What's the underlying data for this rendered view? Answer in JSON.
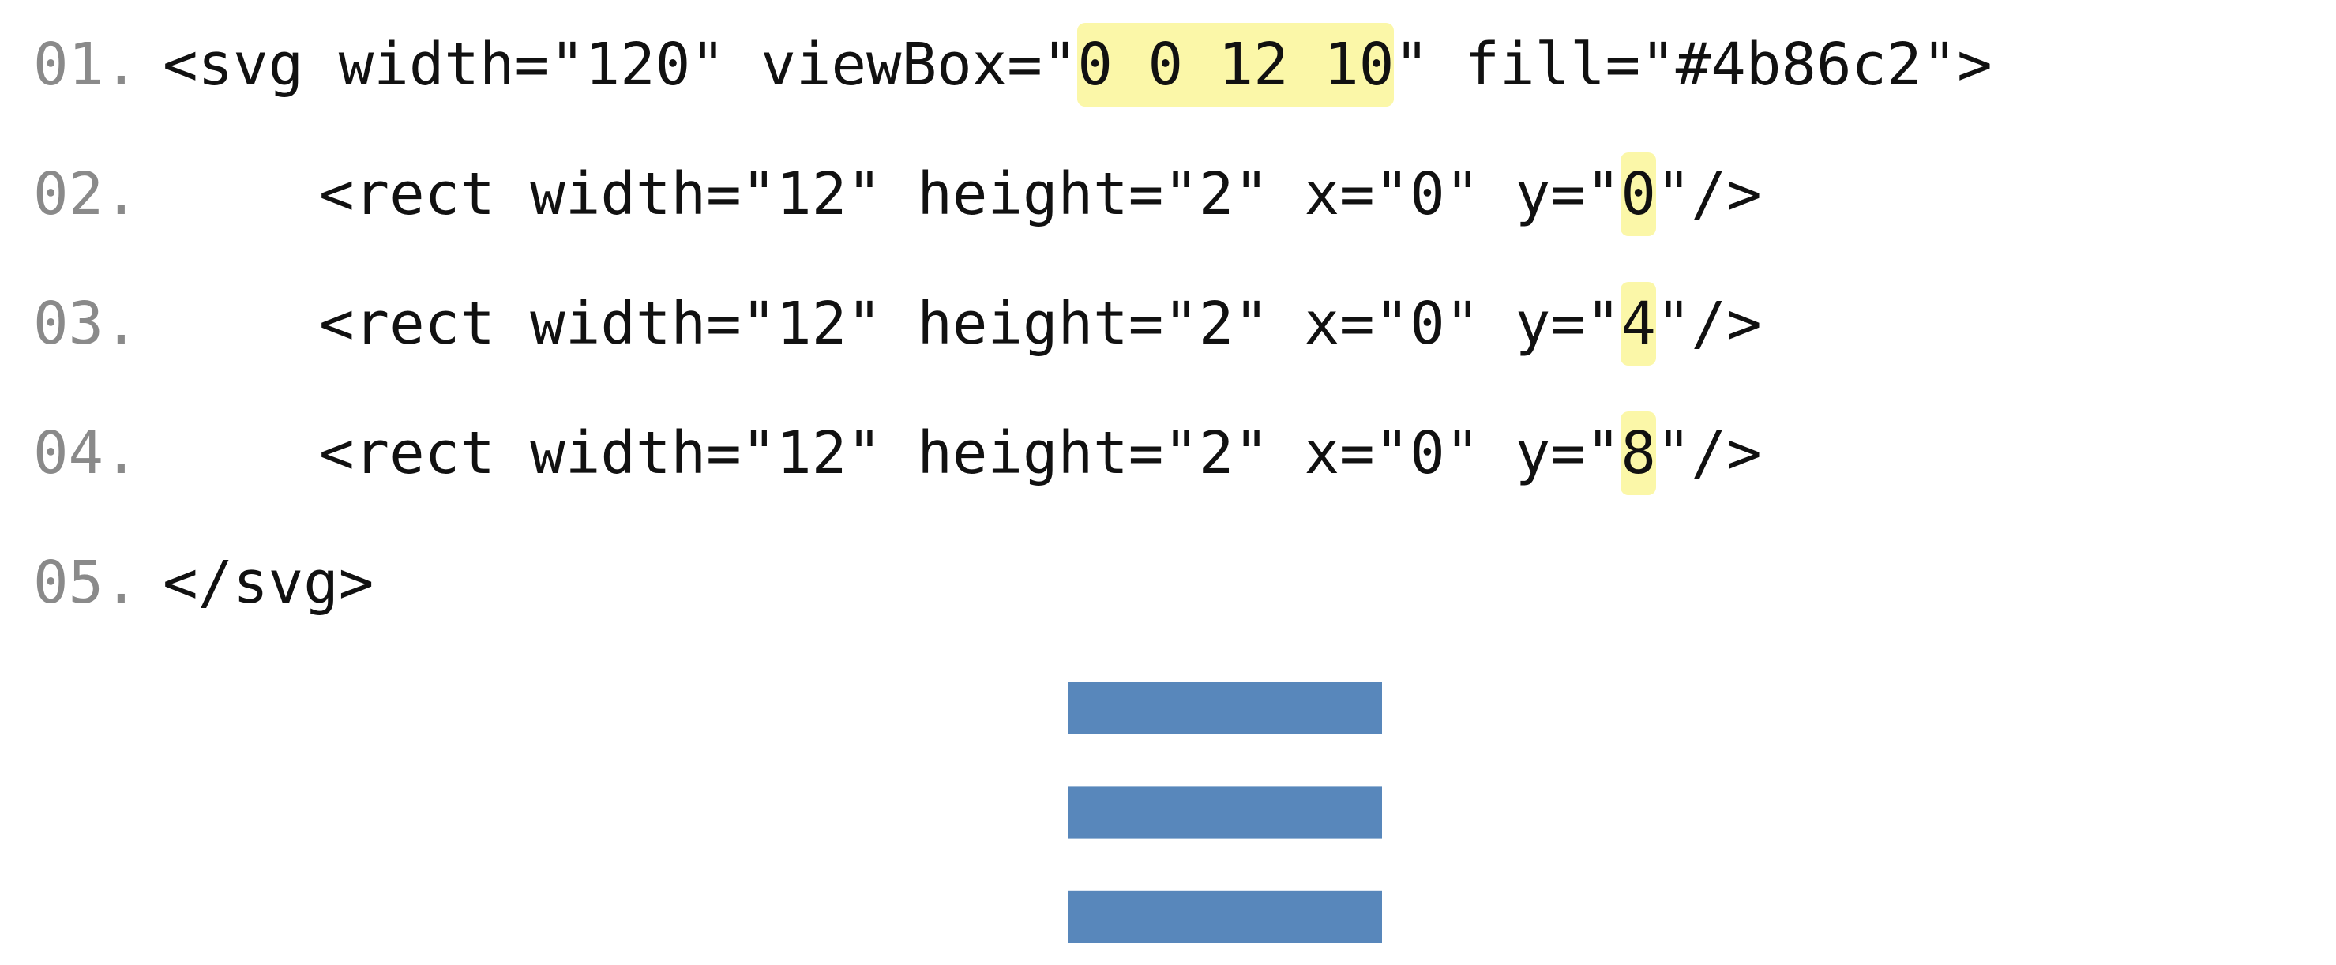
{
  "code": {
    "lines": [
      {
        "number": "01.",
        "pre": "<svg width=\"120\" viewBox=\"",
        "highlight": "0 0 12 10",
        "post": "\" fill=\"#4b86c2\">"
      },
      {
        "number": "02.",
        "pre": "<rect width=\"12\" height=\"2\" x=\"0\" y=\"",
        "highlight": "0",
        "post": "\"/>"
      },
      {
        "number": "03.",
        "pre": "<rect width=\"12\" height=\"2\" x=\"0\" y=\"",
        "highlight": "4",
        "post": "\"/>"
      },
      {
        "number": "04.",
        "pre": "<rect width=\"12\" height=\"2\" x=\"0\" y=\"",
        "highlight": "8",
        "post": "\"/>"
      },
      {
        "number": "05.",
        "pre": "</svg>",
        "highlight": "",
        "post": ""
      }
    ]
  },
  "preview": {
    "fill": "#4b86c2",
    "bar_color_rendered": "#5887bb",
    "viewbox_units": {
      "width": 12,
      "height": 10
    },
    "bars": [
      {
        "x": 0,
        "y": 0,
        "width": 12,
        "height": 2
      },
      {
        "x": 0,
        "y": 4,
        "width": 12,
        "height": 2
      },
      {
        "x": 0,
        "y": 8,
        "width": 12,
        "height": 2
      }
    ]
  },
  "colors": {
    "background": "#ffffff",
    "code_text": "#111111",
    "line_number": "#8a8a8a",
    "highlight": "#fbf7a8"
  }
}
